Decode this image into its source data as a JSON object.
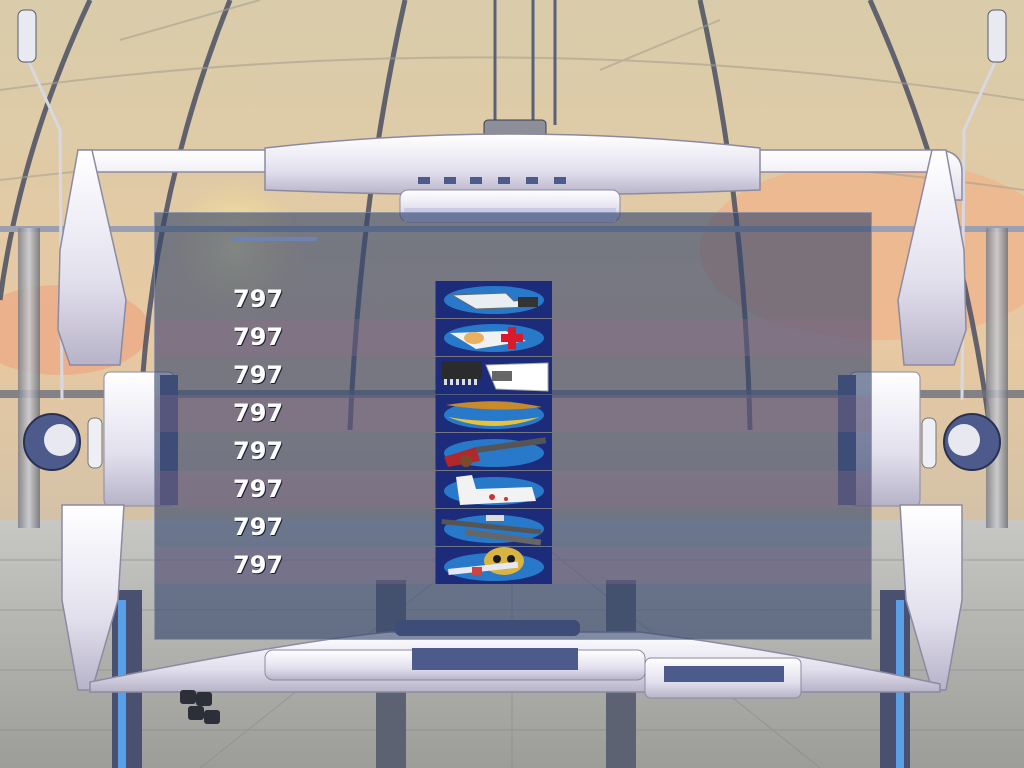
{
  "inventory": {
    "items": [
      {
        "count": "797",
        "icon": "scanner-device-icon"
      },
      {
        "count": "797",
        "icon": "medkit-icon"
      },
      {
        "count": "797",
        "icon": "microchip-icon"
      },
      {
        "count": "797",
        "icon": "banana-icon"
      },
      {
        "count": "797",
        "icon": "shotgun-icon"
      },
      {
        "count": "797",
        "icon": "glove-icon"
      },
      {
        "count": "797",
        "icon": "rifle-icon"
      },
      {
        "count": "797",
        "icon": "skull-syringe-icon"
      }
    ]
  },
  "colors": {
    "panel": "#34466c",
    "frame": "#e8e6f2",
    "frame_accent": "#4d5a8c",
    "text": "#ffffff"
  }
}
